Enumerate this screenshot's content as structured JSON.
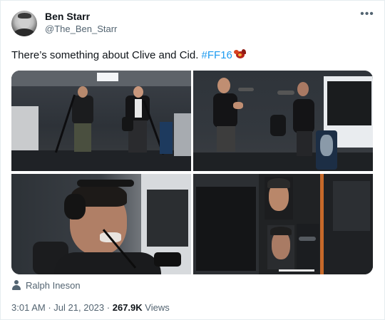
{
  "author": {
    "display_name": "Ben Starr",
    "handle": "@The_Ben_Starr"
  },
  "more_icon": "more-horizontal-icon",
  "tweet": {
    "text_before": "There’s something about Clive and Cid. ",
    "hashtag": "#FF16",
    "hashflag_icon": "ff16-hashflag-icon"
  },
  "media": {
    "image_count": 4
  },
  "tagged": {
    "icon": "person-icon",
    "name": "Ralph Ineson"
  },
  "meta": {
    "time": "3:01 AM",
    "separator": "·",
    "date": "Jul 21, 2023",
    "views_count": "267.9K",
    "views_label": "Views"
  },
  "colors": {
    "accent": "#1d9bf0",
    "secondary_text": "#536471",
    "primary_text": "#0f1419"
  }
}
